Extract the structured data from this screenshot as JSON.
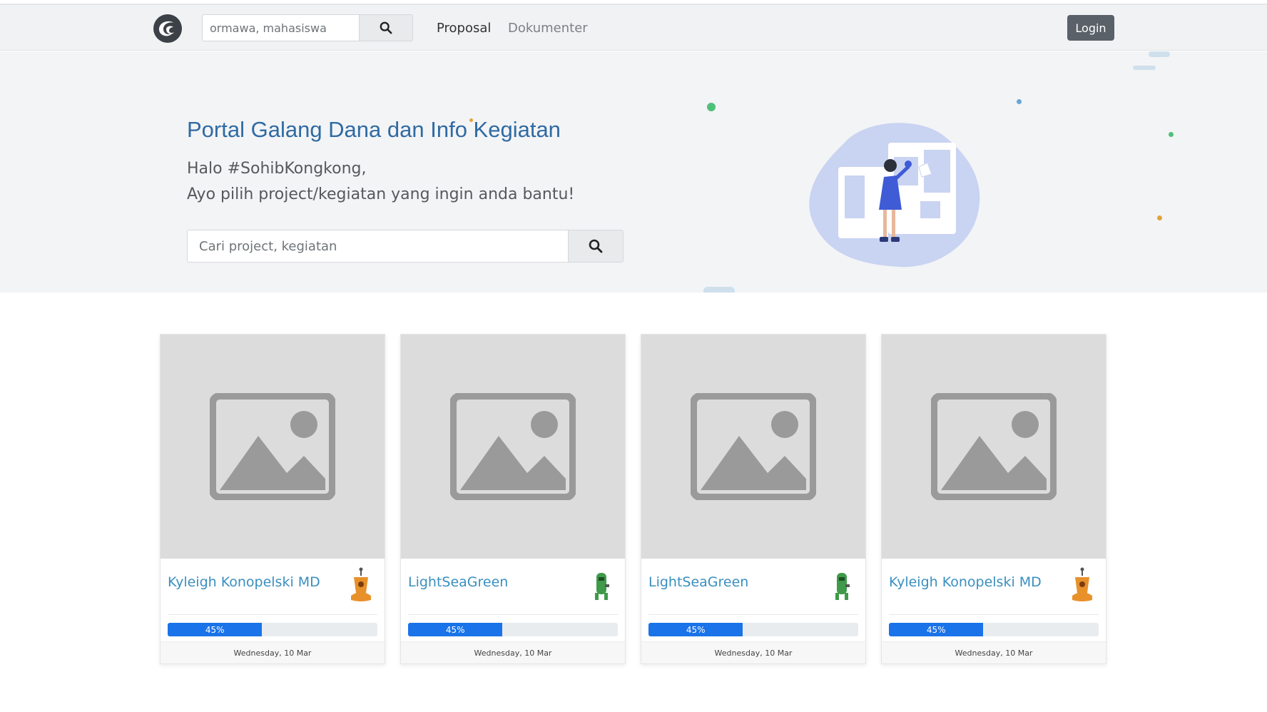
{
  "navbar": {
    "search_placeholder": "ormawa, mahasiswa",
    "links": [
      {
        "label": "Proposal"
      },
      {
        "label": "Dokumenter"
      }
    ],
    "login_label": "Login"
  },
  "hero": {
    "title": "Portal Galang Dana dan Info Kegiatan",
    "greeting": "Halo #SohibKongkong,",
    "subtitle": "Ayo pilih project/kegiatan yang ingin anda bantu!",
    "search_placeholder": "Cari project, kegiatan"
  },
  "cards": [
    {
      "title": "Kyleigh Konopelski MD",
      "progress": 45,
      "progress_label": "45%",
      "date": "Wednesday, 10 Mar",
      "avatar_color": "#e8912b",
      "icon": "robot-avatar-icon"
    },
    {
      "title": "LightSeaGreen",
      "progress": 45,
      "progress_label": "45%",
      "date": "Wednesday, 10 Mar",
      "avatar_color": "#3f9a4a",
      "icon": "robot-avatar-icon"
    },
    {
      "title": "LightSeaGreen",
      "progress": 45,
      "progress_label": "45%",
      "date": "Wednesday, 10 Mar",
      "avatar_color": "#3f9a4a",
      "icon": "robot-avatar-icon"
    },
    {
      "title": "Kyleigh Konopelski MD",
      "progress": 45,
      "progress_label": "45%",
      "date": "Wednesday, 10 Mar",
      "avatar_color": "#e8912b",
      "icon": "robot-avatar-icon"
    }
  ],
  "colors": {
    "accent": "#2f6aa3",
    "link": "#3a8fc0",
    "progress": "#1a73e8",
    "login_bg": "#5a6168"
  }
}
